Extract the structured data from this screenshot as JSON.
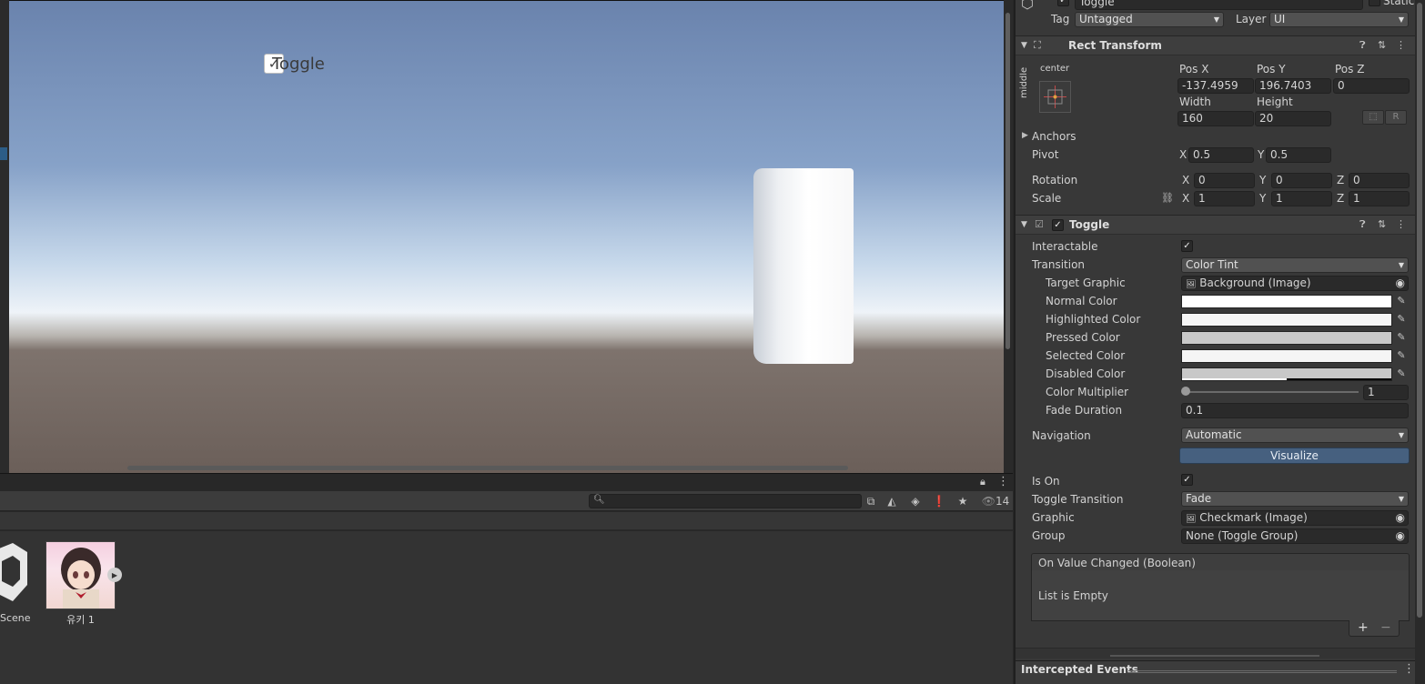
{
  "scene": {
    "toggle_label": "Toggle",
    "toggle_check": "✓"
  },
  "project": {
    "visible_count": "14",
    "assets": [
      {
        "label": "Scene",
        "icon": "unity-scene-icon"
      },
      {
        "label": "유키 1",
        "icon": "image-thumbnail"
      }
    ]
  },
  "inspector": {
    "object_name": "Toggle",
    "static_label": "Static",
    "tag_label": "Tag",
    "tag_value": "Untagged",
    "layer_label": "Layer",
    "layer_value": "UI",
    "rect_transform": {
      "title": "Rect Transform",
      "anchor_h": "center",
      "anchor_v": "middle",
      "posx_label": "Pos X",
      "posx": "-137.4959",
      "posy_label": "Pos Y",
      "posy": "196.7403",
      "posz_label": "Pos Z",
      "posz": "0",
      "width_label": "Width",
      "width": "160",
      "height_label": "Height",
      "height": "20",
      "r_button": "R",
      "anchors_label": "Anchors",
      "pivot_label": "Pivot",
      "pivot_x": "0.5",
      "pivot_y": "0.5",
      "rotation_label": "Rotation",
      "rot_x": "0",
      "rot_y": "0",
      "rot_z": "0",
      "scale_label": "Scale",
      "scale_x": "1",
      "scale_y": "1",
      "scale_z": "1",
      "x": "X",
      "y": "Y",
      "z": "Z"
    },
    "toggle": {
      "title": "Toggle",
      "interactable_label": "Interactable",
      "transition_label": "Transition",
      "transition_value": "Color Tint",
      "target_graphic_label": "Target Graphic",
      "target_graphic_value": "Background (Image)",
      "normal_color_label": "Normal Color",
      "highlighted_color_label": "Highlighted Color",
      "pressed_color_label": "Pressed Color",
      "selected_color_label": "Selected Color",
      "disabled_color_label": "Disabled Color",
      "color_multiplier_label": "Color Multiplier",
      "color_multiplier_value": "1",
      "fade_duration_label": "Fade Duration",
      "fade_duration_value": "0.1",
      "navigation_label": "Navigation",
      "navigation_value": "Automatic",
      "visualize_button": "Visualize",
      "is_on_label": "Is On",
      "toggle_transition_label": "Toggle Transition",
      "toggle_transition_value": "Fade",
      "graphic_label": "Graphic",
      "graphic_value": "Checkmark (Image)",
      "group_label": "Group",
      "group_value": "None (Toggle Group)",
      "event_title": "On Value Changed (Boolean)",
      "event_empty": "List is Empty",
      "add_btn": "+",
      "remove_btn": "−",
      "colors": {
        "normal": "#ffffff",
        "highlighted": "#f5f5f5",
        "pressed": "#c8c8c8",
        "selected": "#f5f5f5",
        "disabled": "#c8c8c8"
      }
    },
    "intercepted_events": "Intercepted Events"
  }
}
